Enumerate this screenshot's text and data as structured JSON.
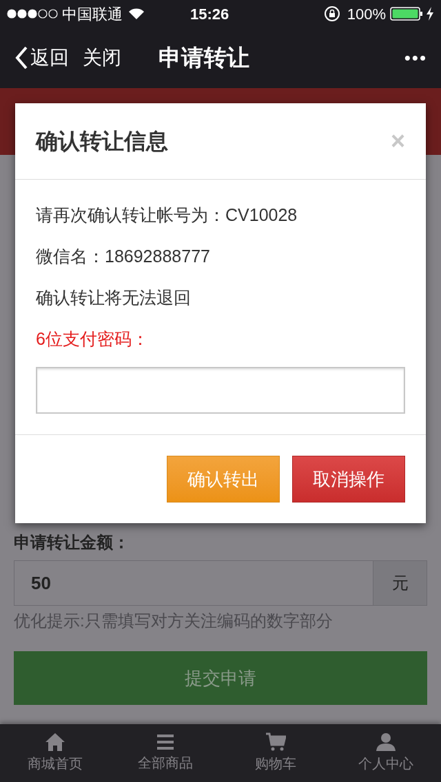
{
  "status_bar": {
    "carrier": "中国联通",
    "time": "15:26",
    "battery": "100%"
  },
  "nav": {
    "back": "返回",
    "close": "关闭",
    "title": "申请转让",
    "more": "•••"
  },
  "form": {
    "amount_label": "申请转让金额：",
    "amount_value": "50",
    "unit": "元",
    "hint": "优化提示:只需填写对方关注编码的数字部分",
    "submit": "提交申请"
  },
  "dialog": {
    "title": "确认转让信息",
    "close": "×",
    "lines": [
      "请再次确认转让帐号为：CV10028",
      "微信名：18692888777",
      "确认转让将无法退回"
    ],
    "password_label": "6位支付密码：",
    "buttons": [
      {
        "label": "确认转出",
        "kind": "confirm"
      },
      {
        "label": "取消操作",
        "kind": "cancel"
      }
    ]
  },
  "tab_bar": [
    {
      "label": "商城首页",
      "kind": "home"
    },
    {
      "label": "全部商品",
      "kind": "list"
    },
    {
      "label": "购物车",
      "kind": "cart"
    },
    {
      "label": "个人中心",
      "kind": "user"
    }
  ]
}
